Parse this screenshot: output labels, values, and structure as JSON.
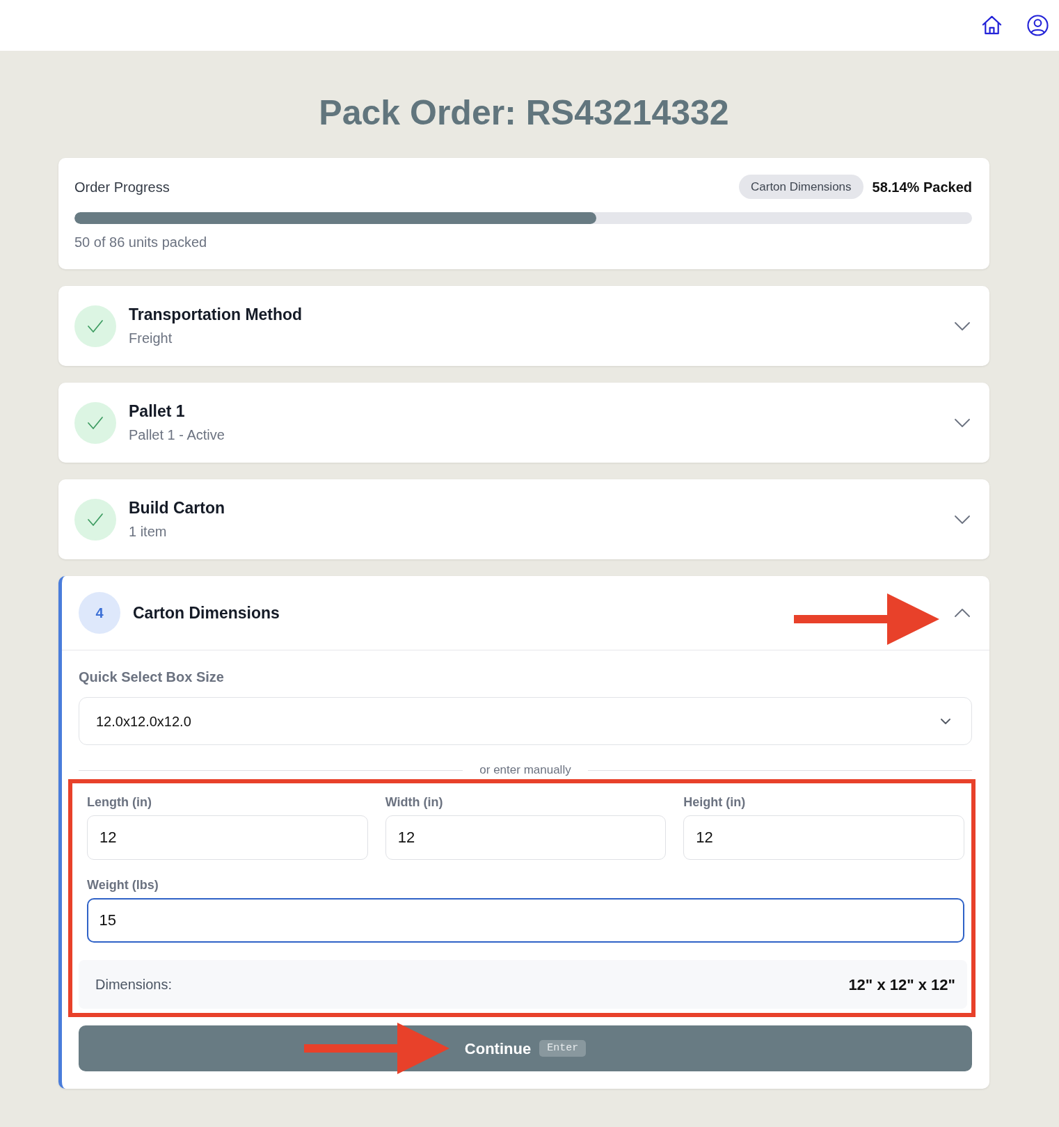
{
  "page": {
    "title": "Pack Order: RS43214332"
  },
  "progress": {
    "label": "Order Progress",
    "current_step": "Carton Dimensions",
    "percent": "58.14% Packed",
    "level": 0.5814,
    "units": "50 of 86 units packed"
  },
  "steps": [
    {
      "title": "Transportation Method",
      "subtitle": "Freight",
      "completed": true,
      "expanded": false
    },
    {
      "title": "Pallet 1",
      "subtitle": "Pallet 1 - Active",
      "completed": true,
      "expanded": false
    },
    {
      "title": "Build Carton",
      "subtitle": "1 item",
      "completed": true,
      "expanded": false
    },
    {
      "number": "4",
      "title": "Carton Dimensions",
      "completed": false,
      "expanded": true,
      "form": {
        "quick_select": {
          "label": "Quick Select Box Size",
          "value": "12.0x12.0x12.0"
        },
        "divider": "or enter manually",
        "field_rows": [
          [
            {
              "label": "Length (in)",
              "value": "12",
              "focused": false
            },
            {
              "label": "Width (in)",
              "value": "12",
              "focused": false
            },
            {
              "label": "Height (in)",
              "value": "12",
              "focused": false
            }
          ],
          [
            {
              "label": "Weight (lbs)",
              "value": "15",
              "focused": true
            }
          ]
        ],
        "summary": {
          "label": "Dimensions:",
          "value": "12\" x 12\" x 12\""
        },
        "button": {
          "label": "Continue",
          "shortcut": "Enter"
        }
      }
    }
  ]
}
